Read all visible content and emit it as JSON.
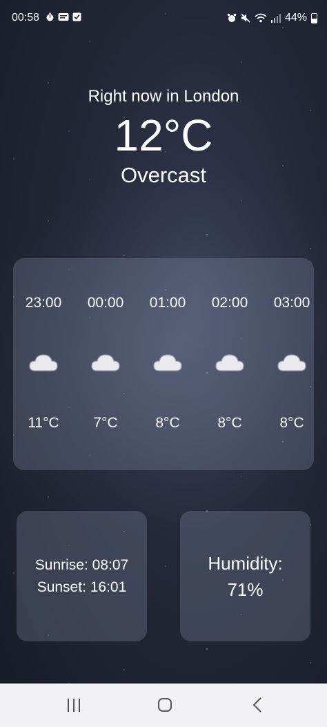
{
  "status_bar": {
    "time": "00:58",
    "left_icons": [
      "timer-icon",
      "notification-icon",
      "checkbox-icon"
    ],
    "right_icons": [
      "alarm-icon",
      "mute-icon",
      "wifi-icon",
      "signal-icon"
    ],
    "battery": "44%"
  },
  "current": {
    "location": "Right now in London",
    "temperature": "12°C",
    "condition": "Overcast"
  },
  "hourly": [
    {
      "time": "23:00",
      "icon": "cloud-icon",
      "temp": "11°C"
    },
    {
      "time": "00:00",
      "icon": "cloud-icon",
      "temp": "7°C"
    },
    {
      "time": "01:00",
      "icon": "cloud-icon",
      "temp": "8°C"
    },
    {
      "time": "02:00",
      "icon": "cloud-icon",
      "temp": "8°C"
    },
    {
      "time": "03:00",
      "icon": "cloud-icon",
      "temp": "8°C"
    }
  ],
  "sun": {
    "sunrise": "Sunrise: 08:07",
    "sunset": "Sunset: 16:01"
  },
  "humidity": {
    "label": "Humidity:",
    "value": "71%"
  },
  "nav": {
    "icons": [
      "recent-apps-icon",
      "home-icon",
      "back-icon"
    ]
  }
}
